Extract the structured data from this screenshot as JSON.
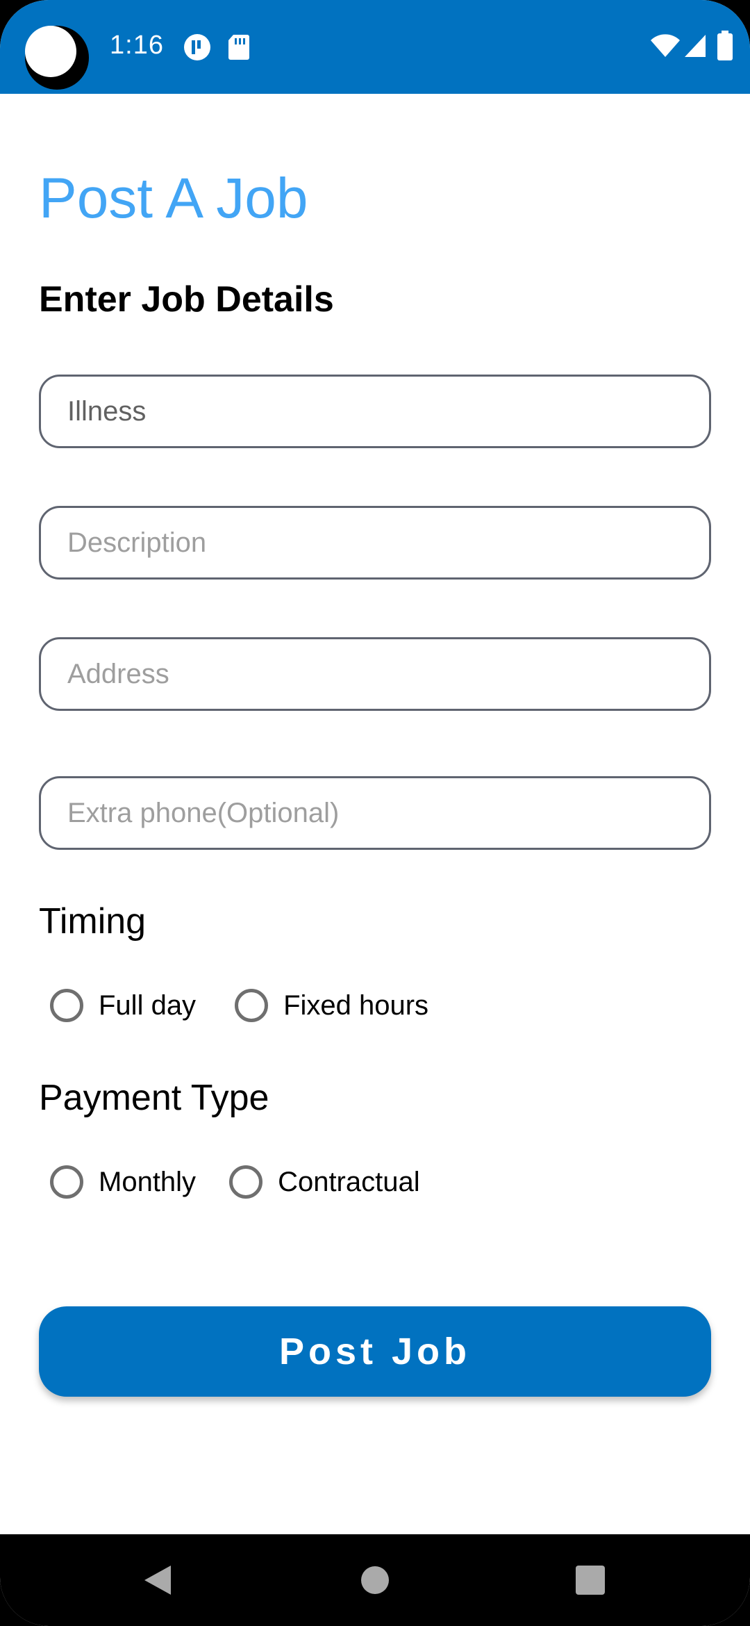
{
  "status_bar": {
    "time": "1:16",
    "icons": [
      "notification-p-icon",
      "sd-card-icon",
      "wifi-icon",
      "cell-signal-icon",
      "battery-icon"
    ],
    "background": "#0172c0"
  },
  "page": {
    "title": "Post A Job",
    "subtitle": "Enter Job Details"
  },
  "form": {
    "illness": {
      "value": "",
      "placeholder": "Illness"
    },
    "description": {
      "value": "",
      "placeholder": "Description"
    },
    "address": {
      "value": "",
      "placeholder": "Address"
    },
    "extra_phone": {
      "value": "",
      "placeholder": "Extra phone(Optional)"
    }
  },
  "timing": {
    "label": "Timing",
    "options": [
      "Full day",
      "Fixed hours"
    ],
    "selected": null
  },
  "payment": {
    "label": "Payment Type",
    "options": [
      "Monthly",
      "Contractual"
    ],
    "selected": null
  },
  "submit": {
    "label": "Post Job"
  },
  "nav": {
    "icons": [
      "back-icon",
      "home-icon",
      "recents-icon"
    ]
  },
  "colors": {
    "accent": "#0172c0",
    "title": "#42a5f5"
  }
}
